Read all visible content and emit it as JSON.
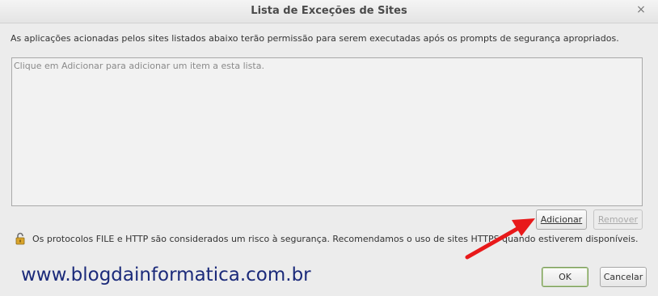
{
  "window": {
    "title": "Lista de Exceções de Sites",
    "close_glyph": "×"
  },
  "description": "As aplicações acionadas pelos sites listados abaixo terão permissão para serem executadas após os prompts de segurança apropriados.",
  "list": {
    "placeholder": "Clique em Adicionar para adicionar um item a esta lista."
  },
  "buttons": {
    "add": "Adicionar",
    "remove": "Remover",
    "ok": "OK",
    "cancel": "Cancelar"
  },
  "notice": {
    "icon": "unlocked-padlock-icon",
    "text": "Os protocolos FILE e HTTP são considerados um risco à segurança. Recomendamos o uso de sites HTTPS quando estiverem disponíveis."
  },
  "watermark": "www.blogdainformatica.com.br",
  "colors": {
    "annotation_arrow": "#e8191a",
    "watermark": "#1b2a7a"
  }
}
